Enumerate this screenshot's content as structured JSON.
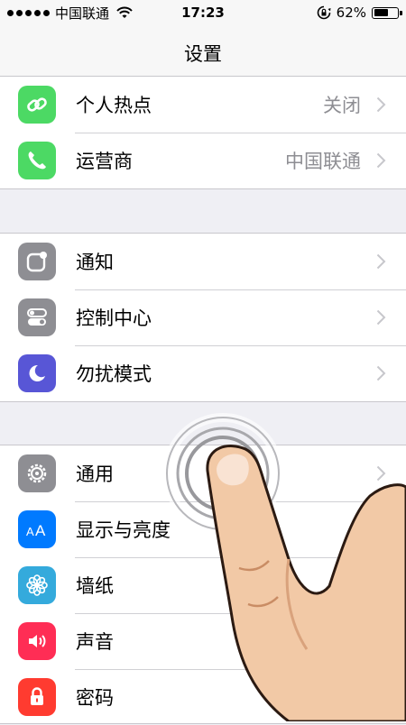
{
  "status_bar": {
    "carrier": "中国联通",
    "time": "17:23",
    "battery": "62%",
    "battery_level": 0.62
  },
  "nav": {
    "title": "设置"
  },
  "groups": [
    {
      "items": [
        {
          "label": "个人热点",
          "value": "关闭",
          "icon": "hotspot-icon",
          "color": "#4cd964"
        },
        {
          "label": "运营商",
          "value": "中国联通",
          "icon": "phone-icon",
          "color": "#4cd964"
        }
      ]
    },
    {
      "items": [
        {
          "label": "通知",
          "icon": "notification-icon",
          "color": "#8e8e93"
        },
        {
          "label": "控制中心",
          "icon": "control-center-icon",
          "color": "#8e8e93"
        },
        {
          "label": "勿扰模式",
          "icon": "moon-icon",
          "color": "#5856d6"
        }
      ]
    },
    {
      "items": [
        {
          "label": "通用",
          "icon": "gear-icon",
          "color": "#8e8e93"
        },
        {
          "label": "显示与亮度",
          "icon": "text-size-icon",
          "color": "#007aff"
        },
        {
          "label": "墙纸",
          "icon": "wallpaper-flower-icon",
          "color": "#34aadc"
        },
        {
          "label": "声音",
          "icon": "speaker-icon",
          "color": "#ff2d55"
        },
        {
          "label": "密码",
          "icon": "lock-icon",
          "color": "#ff3b30"
        }
      ]
    }
  ],
  "overlay": {
    "type": "tap-gesture-hand",
    "icon": "finger-tap-icon"
  }
}
